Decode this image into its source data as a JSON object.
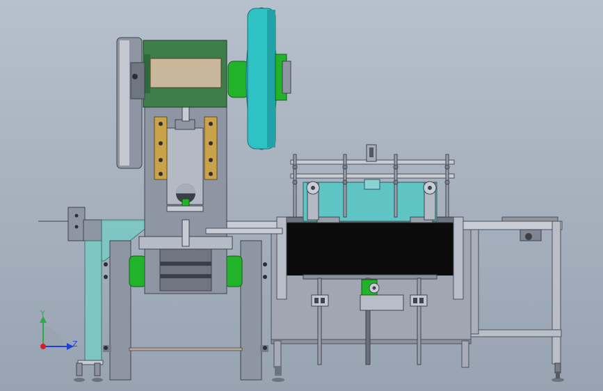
{
  "window": {
    "title": ""
  },
  "triad": {
    "y_label": "Y",
    "z_label": "Z",
    "colors": {
      "y": "#2fa84f",
      "z": "#1f3fd6",
      "origin": "#d62020"
    }
  },
  "colors": {
    "frame_gray": "#8e95a3",
    "frame_dark": "#5f6673",
    "head_green": "#3f7d4b",
    "flywheel_teal": "#2fc2c4",
    "hub_green": "#21b32a",
    "plate_tan": "#c9b79b",
    "bracket_gold": "#c9a24a",
    "belt_black": "#0b0b0b",
    "tray_teal": "#5fc4c4"
  },
  "icons": [
    "coordinate-triad-icon"
  ]
}
